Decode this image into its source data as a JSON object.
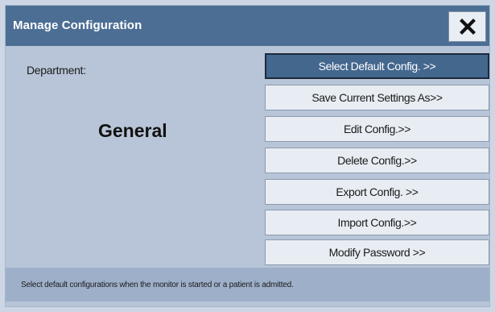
{
  "dialog": {
    "title": "Manage Configuration",
    "close_icon": "close-icon"
  },
  "department": {
    "label": "Department:",
    "value": "General"
  },
  "menu": {
    "items": [
      {
        "label": "Select Default Config. >>",
        "selected": true
      },
      {
        "label": "Save Current Settings As>>",
        "selected": false
      },
      {
        "label": "Edit Config.>>",
        "selected": false
      },
      {
        "label": "Delete Config.>>",
        "selected": false
      },
      {
        "label": "Export Config. >>",
        "selected": false
      },
      {
        "label": "Import Config.>>",
        "selected": false
      },
      {
        "label": "Modify Password >>",
        "selected": false
      }
    ]
  },
  "status": {
    "text": "Select default configurations when the monitor is started or a patient is admitted."
  },
  "colors": {
    "titlebar": "#4c6e94",
    "selected_button": "#44678e",
    "dialog_background": "#b8c5d8",
    "status_bar": "#9eb0c9"
  }
}
